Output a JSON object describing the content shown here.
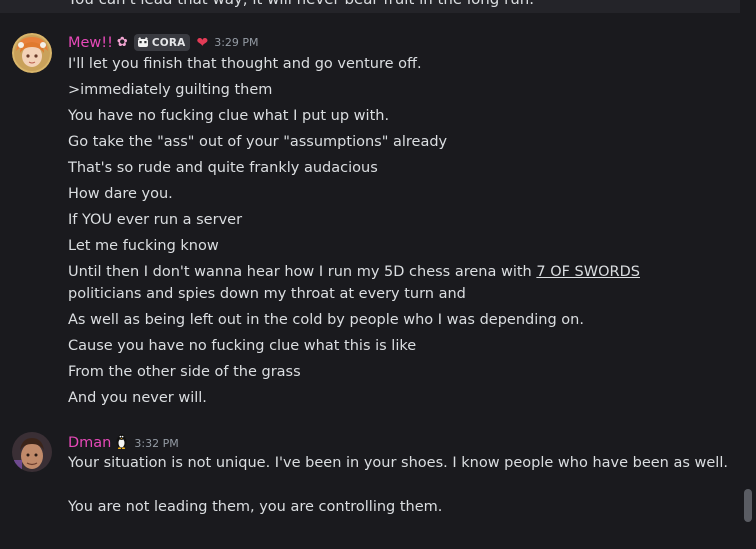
{
  "previous_message": {
    "text": "You can't lead that way, it will never bear fruit in the long run."
  },
  "messages": [
    {
      "author": "Mew!!",
      "author_color": "#e649b8",
      "clan_tag": "CORA",
      "badges": [
        "flower-icon",
        "clan-tag-icon",
        "heart-icon"
      ],
      "time": "3:29 PM",
      "lines": [
        "I'll let you finish that thought and go venture off.",
        ">immediately guilting them",
        "You have no fucking clue what I put up with.",
        "Go take the \"ass\" out of your \"assumptions\" already",
        "That's so rude and quite frankly audacious",
        "How dare you.",
        "If YOU ever run a server",
        "Let me fucking know"
      ],
      "long_line": {
        "before": "Until then I don't wanna hear how I run my 5D chess arena with ",
        "link": "7 OF SWORDS",
        "after": " politicians and spies down my throat at every turn and"
      },
      "lines_after": [
        "As well as being left out in the cold by people who I was depending on.",
        "Cause you have no fucking clue what this is like",
        "From the other side of the grass",
        "And you never will."
      ]
    },
    {
      "author": "Dman",
      "author_color": "#e649b8",
      "badges": [
        "penguin-icon"
      ],
      "time": "3:32 PM",
      "lines": [
        "Your situation is not unique. I've been in your shoes. I know people who have been as well.",
        "You are not leading them, you are controlling them."
      ]
    }
  ]
}
